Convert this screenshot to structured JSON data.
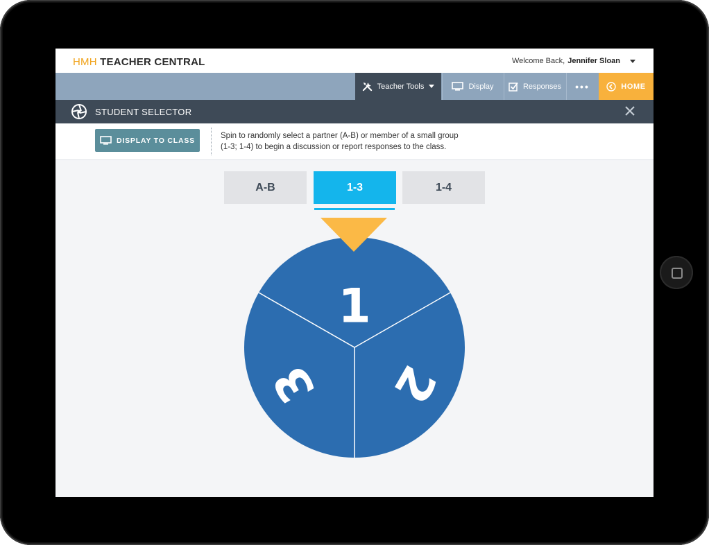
{
  "app": {
    "brand_prefix": "HMH",
    "brand_name": "TEACHER CENTRAL",
    "welcome_text": "Welcome Back,",
    "user_name": "Jennifer Sloan"
  },
  "nav": {
    "teacher_tools": "Teacher Tools",
    "display": "Display",
    "responses": "Responses",
    "more": "•••",
    "home": "HOME"
  },
  "tool": {
    "title": "STUDENT SELECTOR",
    "display_button": "DISPLAY TO CLASS",
    "instructions_line1": "Spin to randomly select a partner (A-B) or member of a small group",
    "instructions_line2": "(1-3; 1-4) to begin a discussion or report responses to the class."
  },
  "tabs": [
    {
      "label": "A-B",
      "selected": false
    },
    {
      "label": "1-3",
      "selected": true
    },
    {
      "label": "1-4",
      "selected": false
    }
  ],
  "wheel": {
    "segments": [
      "1",
      "2",
      "3"
    ],
    "pointer": "pointer-arrow"
  },
  "colors": {
    "wheel_blue": "#2c6db0",
    "pointer_yellow": "#fbb946",
    "selected_tab": "#14b5ec",
    "home_orange": "#f8b13c",
    "nav_dark": "#3e4a57",
    "nav_light": "#8ea5bc",
    "display_button": "#5b8e9b"
  },
  "icons": {
    "teacher_tools": "tools-icon",
    "display": "monitor-icon",
    "responses": "checkbox-icon",
    "home": "chevron-left-circle-icon",
    "selector": "aperture-icon",
    "close": "close-icon",
    "display_button": "monitor-icon"
  }
}
